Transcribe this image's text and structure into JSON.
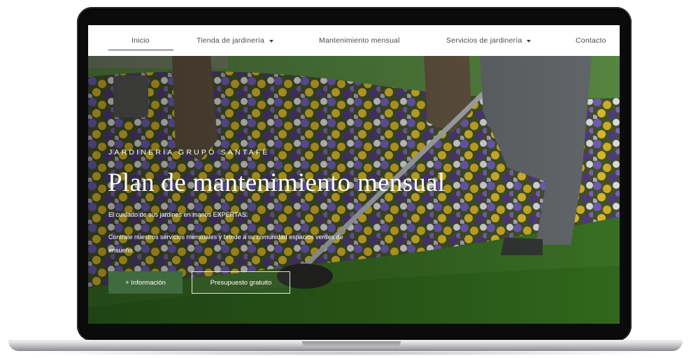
{
  "nav": {
    "items": [
      {
        "label": "Inicio",
        "active": true,
        "dropdown": false
      },
      {
        "label": "Tienda de jardinería",
        "active": false,
        "dropdown": true
      },
      {
        "label": "Mantenimiento mensual",
        "active": false,
        "dropdown": false
      },
      {
        "label": "Servicios de jardinería",
        "active": false,
        "dropdown": true
      },
      {
        "label": "Contacto",
        "active": false,
        "dropdown": false
      }
    ]
  },
  "hero": {
    "eyebrow": "JARDINERÍA GRUPO SANTAFÉ",
    "title": "Plan de mantenimiento mensual",
    "line1": "El cuidado de sus jardines en manos EXPERTAS.",
    "line2": "Contrate nuestros servicios mensuales y brinde a su comunidad espacios verdes de ensueño.",
    "primary_button": "+ Información",
    "secondary_button": "Presupuesto gratuito"
  },
  "colors": {
    "accent": "#3f6b3f",
    "nav_text": "#4a4a4a",
    "frame": "#0b0b0c"
  }
}
